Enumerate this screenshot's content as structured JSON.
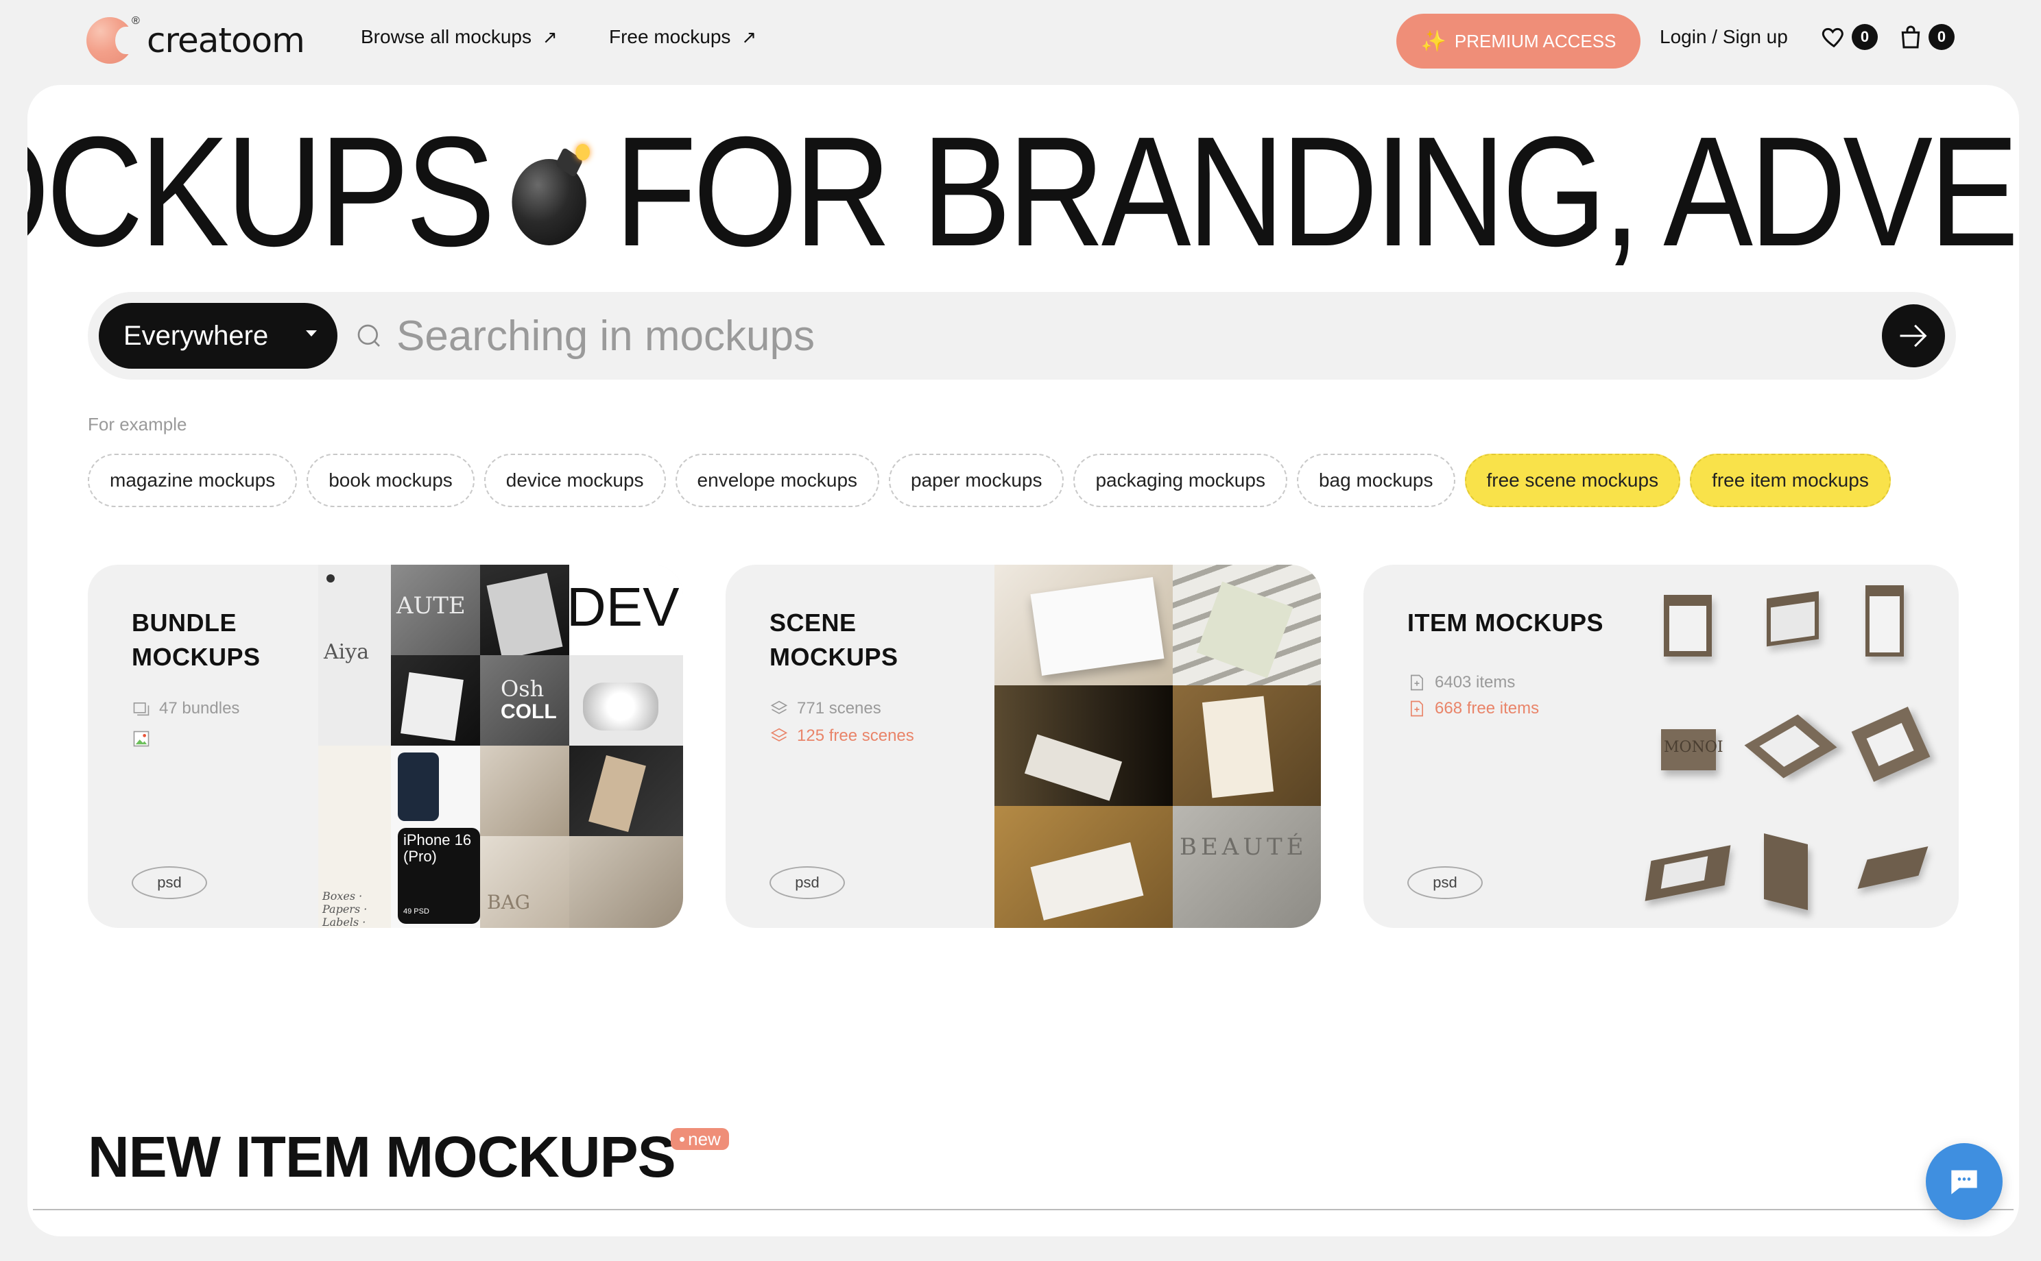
{
  "brand": {
    "name": "creatoom",
    "reg": "®"
  },
  "nav": {
    "browse_all": "Browse all mockups",
    "free": "Free mockups",
    "premium": "PREMIUM ACCESS",
    "login": "Login / Sign up",
    "favorites_count": "0",
    "cart_count": "0"
  },
  "marquee": {
    "left_text": "OCKUPS",
    "right_text": "FOR BRANDING, ADVERTIS"
  },
  "search": {
    "scope_label": "Everywhere",
    "placeholder": "Searching in mockups"
  },
  "examples": {
    "label": "For example",
    "chips": [
      "magazine mockups",
      "book mockups",
      "device mockups",
      "envelope mockups",
      "paper mockups",
      "packaging mockups",
      "bag mockups",
      "free scene mockups",
      "free item mockups"
    ]
  },
  "categories": [
    {
      "title_line1": "BUNDLE",
      "title_line2": "MOCKUPS",
      "stat1": "47 bundles",
      "format": "psd"
    },
    {
      "title_line1": "SCENE",
      "title_line2": "MOCKUPS",
      "stat1": "771 scenes",
      "stat2": "125 free scenes",
      "format": "psd"
    },
    {
      "title_line1": "ITEM MOCKUPS",
      "stat1": "6403 items",
      "stat2": "668 free items",
      "format": "psd"
    }
  ],
  "bundle_tiles": {
    "aiya": "Aiya",
    "aute": "AUTE",
    "dev": "DEV",
    "osh": "Osh",
    "coll": "COLL",
    "iphone_title": "iPhone 16 (Pro)",
    "iphone_sub": "49 PSD",
    "boxes": "Boxes · Papers · Labels · Bags",
    "bag": "BAG"
  },
  "scene_tiles": {
    "beaute": "BEAUTÉ"
  },
  "item_tiles": {
    "monoi": "MONOI"
  },
  "section": {
    "title": "NEW ITEM MOCKUPS",
    "badge": "new"
  },
  "colors": {
    "accent": "#ef8e78",
    "yellow_chip": "#f9e24a",
    "chat": "#3f8fe0",
    "box_brown": "#7a6a58"
  }
}
